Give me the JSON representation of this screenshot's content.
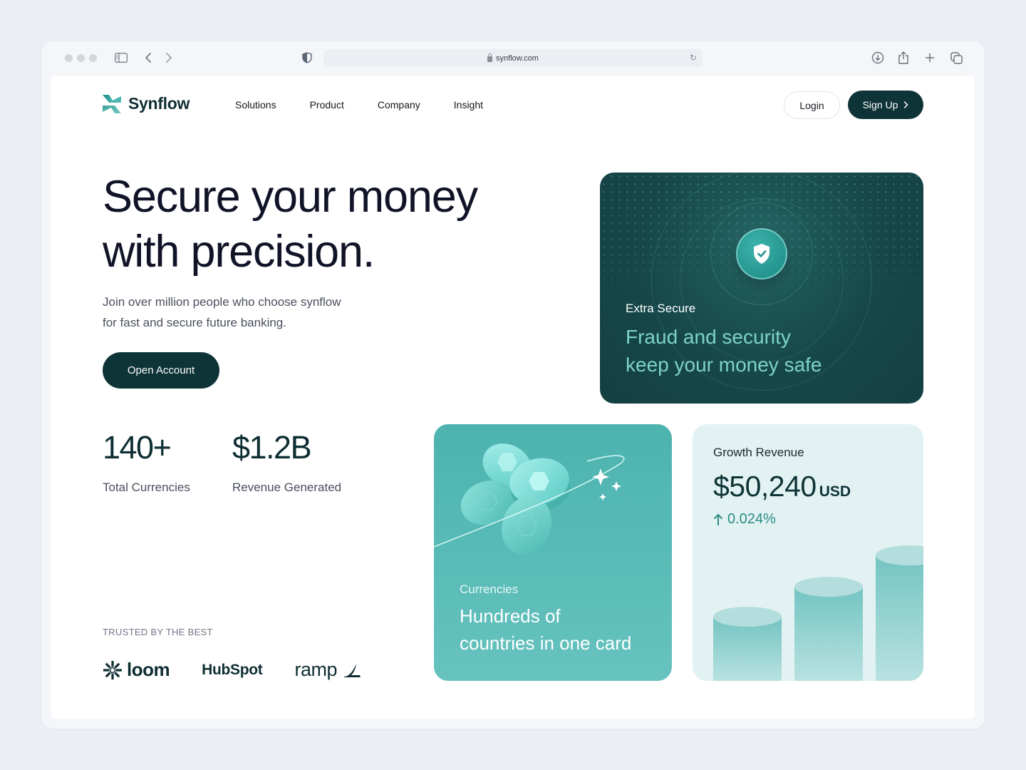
{
  "browser": {
    "url": "synflow.com"
  },
  "nav": {
    "brand": "Synflow",
    "links": [
      "Solutions",
      "Product",
      "Company",
      "Insight"
    ],
    "login_label": "Login",
    "signup_label": "Sign Up"
  },
  "hero": {
    "title_line1": "Secure your money",
    "title_line2": "with precision.",
    "subtitle_line1": "Join over million people who choose synflow",
    "subtitle_line2": "for fast and secure future banking.",
    "cta_label": "Open Account"
  },
  "stats": [
    {
      "value": "140+",
      "label": "Total Currencies"
    },
    {
      "value": "$1.2B",
      "label": "Revenue Generated"
    }
  ],
  "trusted": {
    "heading": "TRUSTED BY THE BEST",
    "brands": [
      "loom",
      "HubSpot",
      "ramp"
    ]
  },
  "cards": {
    "secure": {
      "eyebrow": "Extra Secure",
      "title_line1": "Fraud and security",
      "title_line2": "keep your money safe"
    },
    "currency": {
      "eyebrow": "Currencies",
      "title_line1": "Hundreds of",
      "title_line2": "countries in one card"
    },
    "growth": {
      "eyebrow": "Growth Revenue",
      "value": "$50,240",
      "currency": "USD",
      "change": "0.024%",
      "bar_levels": [
        0.45,
        0.66,
        0.88
      ]
    }
  },
  "colors": {
    "brand_dark": "#0f3437",
    "accent_teal": "#4db3af",
    "mint_text": "#7ed3c6"
  }
}
